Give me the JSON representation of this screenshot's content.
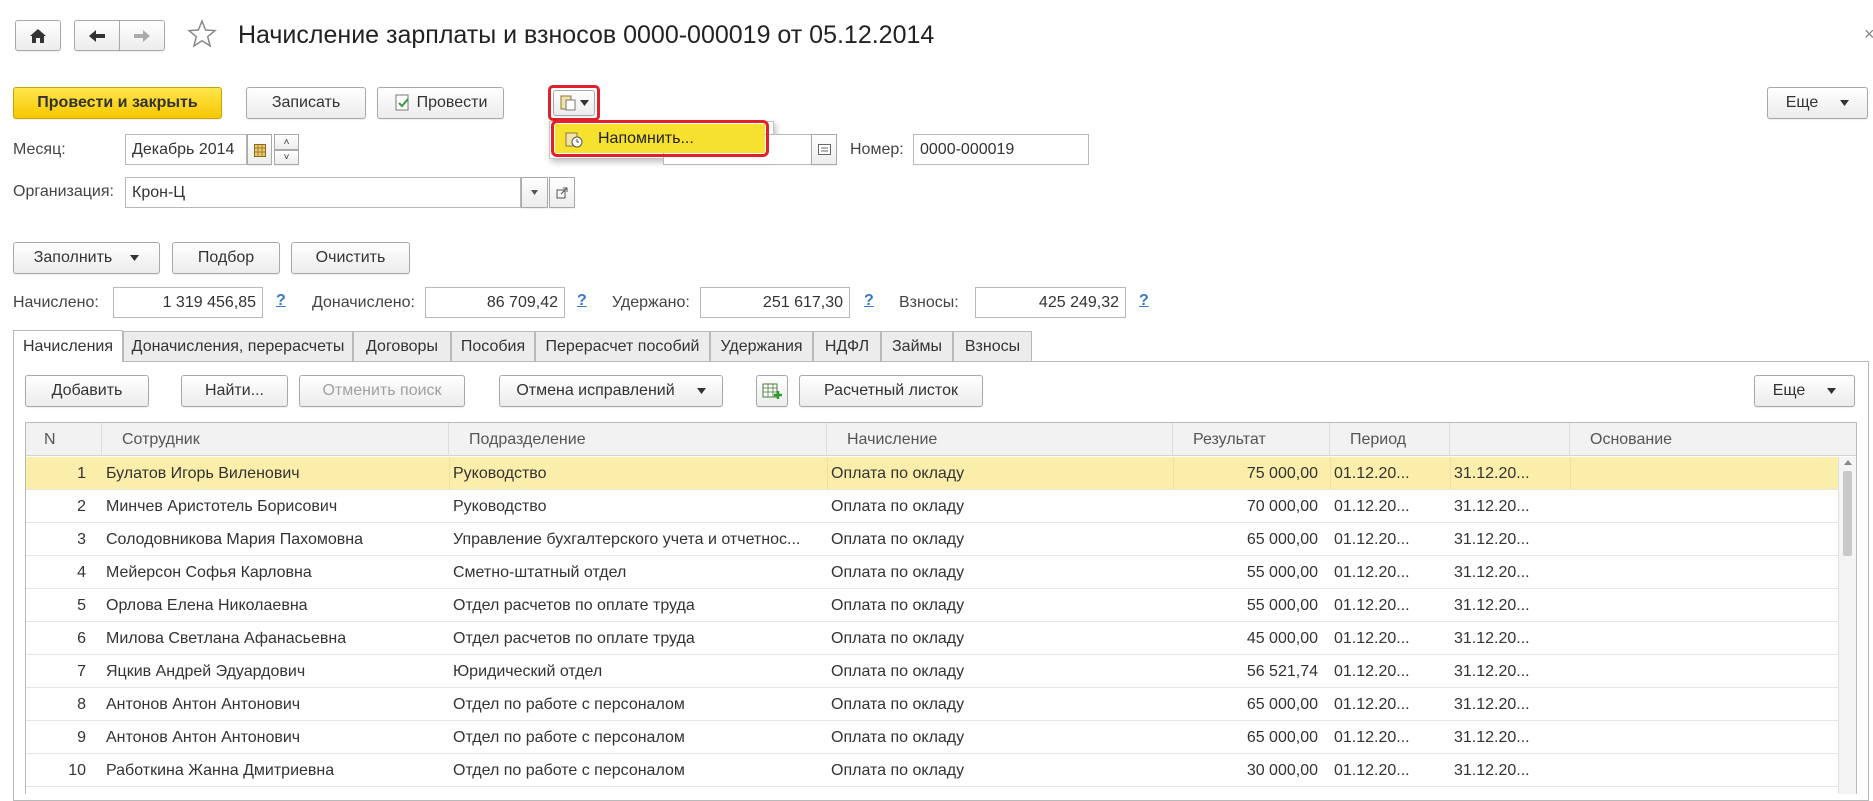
{
  "title": "Начисление зарплаты и взносов 0000-000019 от 05.12.2014",
  "toolbar": {
    "post_close": "Провести и закрыть",
    "save": "Записать",
    "post": "Провести",
    "more": "Еще"
  },
  "dropdown": {
    "remind": "Напомнить..."
  },
  "header": {
    "month_label": "Месяц:",
    "month_value": "Декабрь 2014",
    "org_label": "Организация:",
    "org_value": "Крон-Ц",
    "number_label": "Номер:",
    "number_value": "0000-000019"
  },
  "actions": {
    "fill": "Заполнить",
    "pick": "Подбор",
    "clear": "Очистить"
  },
  "totals": {
    "accrued_label": "Начислено:",
    "accrued_value": "1 319 456,85",
    "extra_label": "Доначислено:",
    "extra_value": "86 709,42",
    "withheld_label": "Удержано:",
    "withheld_value": "251 617,30",
    "contrib_label": "Взносы:",
    "contrib_value": "425 249,32",
    "help": "?"
  },
  "tabs": [
    "Начисления",
    "Доначисления, перерасчеты",
    "Договоры",
    "Пособия",
    "Перерасчет пособий",
    "Удержания",
    "НДФЛ",
    "Займы",
    "Взносы"
  ],
  "grid_toolbar": {
    "add": "Добавить",
    "find": "Найти...",
    "cancel_search": "Отменить поиск",
    "cancel_fix": "Отмена исправлений",
    "payslip": "Расчетный листок",
    "more": "Еще"
  },
  "columns": {
    "n": "N",
    "employee": "Сотрудник",
    "department": "Подразделение",
    "accrual": "Начисление",
    "result": "Результат",
    "period": "Период",
    "basis": "Основание"
  },
  "rows": [
    {
      "n": "1",
      "employee": "Булатов Игорь Виленович",
      "department": "Руководство",
      "accrual": "Оплата по окладу",
      "result": "75 000,00",
      "from": "01.12.20...",
      "to": "31.12.20..."
    },
    {
      "n": "2",
      "employee": "Минчев Аристотель Борисович",
      "department": "Руководство",
      "accrual": "Оплата по окладу",
      "result": "70 000,00",
      "from": "01.12.20...",
      "to": "31.12.20..."
    },
    {
      "n": "3",
      "employee": "Солодовникова Мария Пахомовна",
      "department": "Управление бухгалтерского учета и отчетнос...",
      "accrual": "Оплата по окладу",
      "result": "65 000,00",
      "from": "01.12.20...",
      "to": "31.12.20..."
    },
    {
      "n": "4",
      "employee": "Мейерсон Софья Карловна",
      "department": "Сметно-штатный отдел",
      "accrual": "Оплата по окладу",
      "result": "55 000,00",
      "from": "01.12.20...",
      "to": "31.12.20..."
    },
    {
      "n": "5",
      "employee": "Орлова Елена Николаевна",
      "department": "Отдел расчетов по оплате труда",
      "accrual": "Оплата по окладу",
      "result": "55 000,00",
      "from": "01.12.20...",
      "to": "31.12.20..."
    },
    {
      "n": "6",
      "employee": "Милова Светлана Афанасьевна",
      "department": "Отдел расчетов по оплате труда",
      "accrual": "Оплата по окладу",
      "result": "45 000,00",
      "from": "01.12.20...",
      "to": "31.12.20..."
    },
    {
      "n": "7",
      "employee": "Яцкив Андрей Эдуардович",
      "department": "Юридический отдел",
      "accrual": "Оплата по окладу",
      "result": "56 521,74",
      "from": "01.12.20...",
      "to": "31.12.20..."
    },
    {
      "n": "8",
      "employee": "Антонов Антон Антонович",
      "department": "Отдел по работе с персоналом",
      "accrual": "Оплата по окладу",
      "result": "65 000,00",
      "from": "01.12.20...",
      "to": "31.12.20..."
    },
    {
      "n": "9",
      "employee": "Антонов Антон Антонович",
      "department": "Отдел по работе с персоналом",
      "accrual": "Оплата по окладу",
      "result": "65 000,00",
      "from": "01.12.20...",
      "to": "31.12.20..."
    },
    {
      "n": "10",
      "employee": "Работкина Жанна Дмитриевна",
      "department": "Отдел по работе с персоналом",
      "accrual": "Оплата по окладу",
      "result": "30 000,00",
      "from": "01.12.20...",
      "to": "31.12.20..."
    }
  ],
  "colors": {
    "accent_yellow": "#f5c800",
    "selected_row": "#fbeeaa",
    "highlight_red": "#e0202a",
    "link_blue": "#3b78c4"
  }
}
